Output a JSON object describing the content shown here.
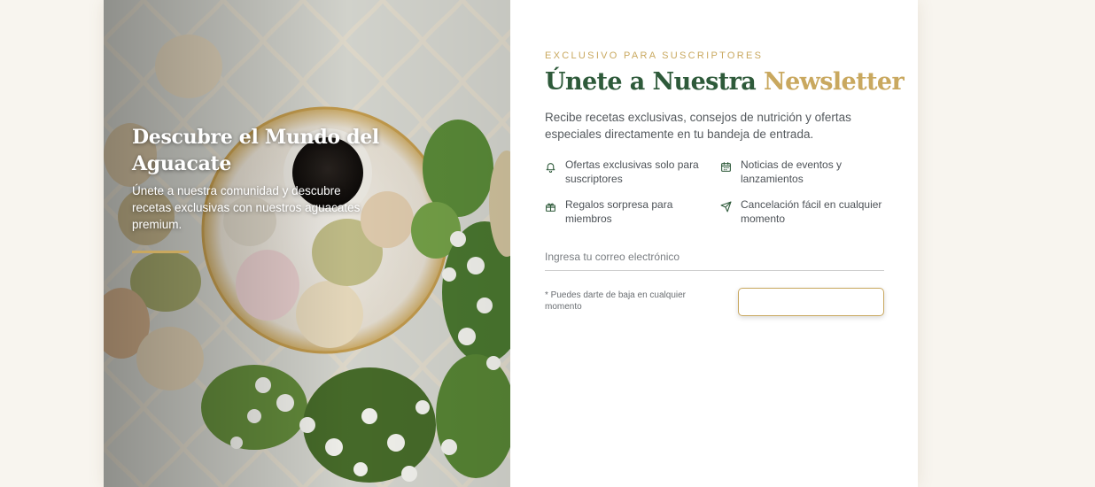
{
  "colors": {
    "page_background": "#f8f5ef",
    "brand_green": "#2e5a3a",
    "accent_gold": "#c9a85f",
    "body_text": "#555a5e"
  },
  "hero": {
    "image_subject": "macarons, coffee cup and white blossoms on a plate",
    "title": "Descubre el Mundo del Aguacate",
    "text": "Únete a nuestra comunidad y descubre recetas exclusivas con nuestros aguacates premium."
  },
  "newsletter": {
    "eyebrow": "EXCLUSIVO PARA SUSCRIPTORES",
    "heading_main": "Únete a Nuestra",
    "heading_accent": "Newsletter",
    "intro": "Recibe recetas exclusivas, consejos de nutrición y ofertas especiales directamente en tu bandeja de entrada.",
    "benefits": [
      {
        "icon": "bell-icon",
        "text": "Ofertas exclusivas solo para suscriptores"
      },
      {
        "icon": "calendar-icon",
        "text": "Noticias de eventos y lanzamientos"
      },
      {
        "icon": "gift-icon",
        "text": "Regalos sorpresa para miembros"
      },
      {
        "icon": "send-icon",
        "text": "Cancelación fácil en cualquier momento"
      }
    ],
    "email_placeholder": "Ingresa tu correo electrónico",
    "email_value": "",
    "footnote": "* Puedes darte de baja en cualquier momento",
    "submit_label": ""
  }
}
